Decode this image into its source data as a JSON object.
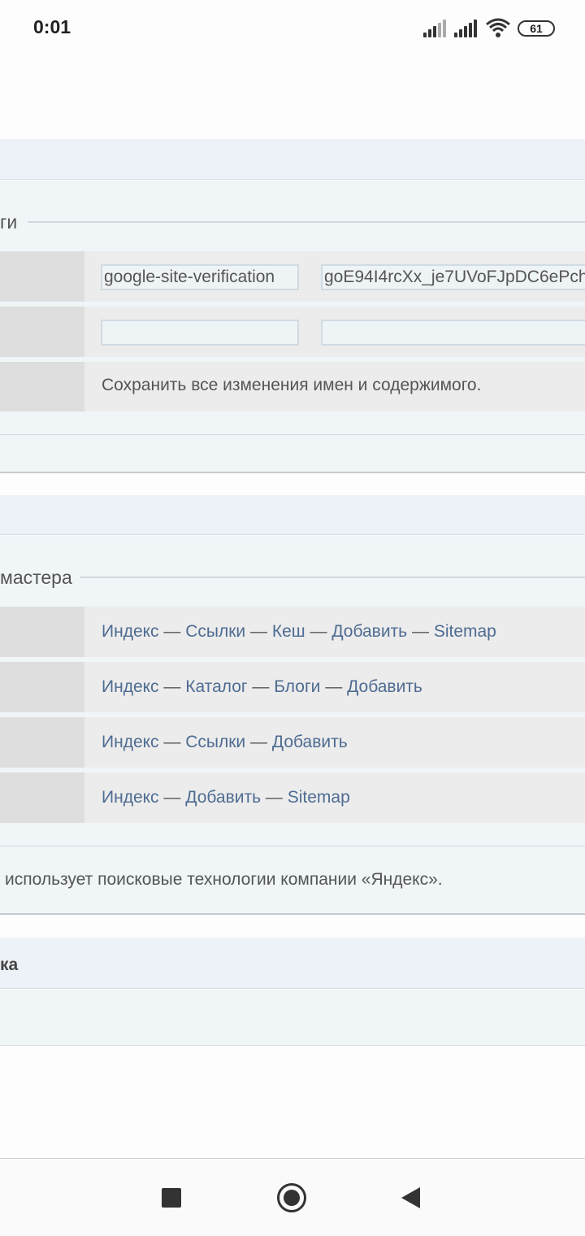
{
  "status_bar": {
    "time": "0:01",
    "battery": "61"
  },
  "section1": {
    "legend": "ги",
    "meta_rows": [
      {
        "name": "google-site-verification",
        "content": "goE94I4rcXx_je7UVoFJpDC6ePch"
      },
      {
        "name": "",
        "content": ""
      }
    ],
    "save_note": "Сохранить все изменения имен и содержимого."
  },
  "section2": {
    "legend": "мастера",
    "rows": [
      {
        "links": [
          "Индекс",
          "Ссылки",
          "Кеш",
          "Добавить",
          "Sitemap"
        ]
      },
      {
        "links": [
          "Индекс",
          "Каталог",
          "Блоги",
          "Добавить"
        ]
      },
      {
        "links": [
          "Индекс",
          "Ссылки",
          "Добавить"
        ]
      },
      {
        "links": [
          "Индекс",
          "Добавить",
          "Sitemap"
        ]
      }
    ],
    "separator": "—",
    "footer_note": "использует поисковые технологии компании «Яндекс»."
  },
  "section3": {
    "title": "ка"
  },
  "nav": {
    "icons": [
      "square-icon",
      "home-circle-icon",
      "back-triangle-icon"
    ]
  }
}
